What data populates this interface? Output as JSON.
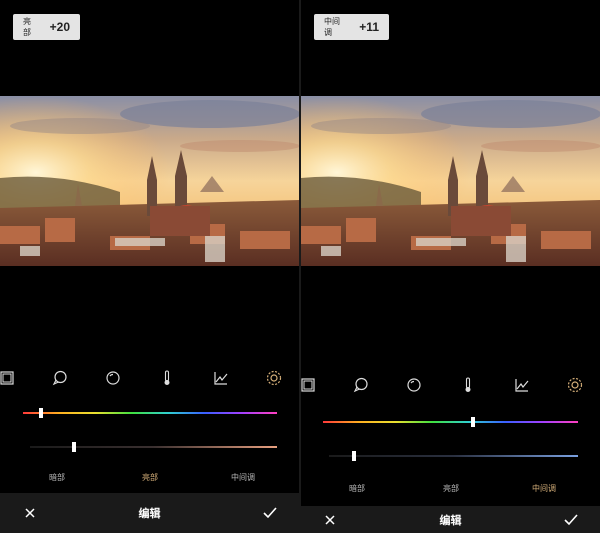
{
  "colors": {
    "accent": "#d6b07a",
    "background": "#000000",
    "bottom_bar": "#1a1a1a",
    "badge_bg": "#e4e4e4"
  },
  "panels": [
    {
      "badge": {
        "label": "亮部",
        "value": "+20"
      },
      "tools": [
        "crop-icon",
        "speech-bubble-icon",
        "circle-icon",
        "thermometer-icon",
        "curve-icon",
        "gear-icon"
      ],
      "active_tool": "gear-icon",
      "sliders": [
        {
          "name": "hue-slider",
          "level": 0.07
        },
        {
          "name": "saturation-slider",
          "level": 0.18
        }
      ],
      "tabs": [
        {
          "label": "暗部",
          "active": false
        },
        {
          "label": "亮部",
          "active": true
        },
        {
          "label": "中间调",
          "active": false
        }
      ],
      "bottom": {
        "title": "编辑",
        "cancel_icon": "close-icon",
        "confirm_icon": "check-icon"
      }
    },
    {
      "badge": {
        "label": "中间调",
        "value": "+11"
      },
      "tools": [
        "crop-icon",
        "speech-bubble-icon",
        "circle-icon",
        "thermometer-icon",
        "curve-icon",
        "gear-icon"
      ],
      "active_tool": "gear-icon",
      "sliders": [
        {
          "name": "hue-slider",
          "level": 0.59
        },
        {
          "name": "saturation-slider",
          "level": 0.12
        }
      ],
      "tabs": [
        {
          "label": "暗部",
          "active": false
        },
        {
          "label": "亮部",
          "active": false
        },
        {
          "label": "中间调",
          "active": true
        }
      ],
      "bottom": {
        "title": "编辑",
        "cancel_icon": "close-icon",
        "confirm_icon": "check-icon"
      }
    }
  ]
}
